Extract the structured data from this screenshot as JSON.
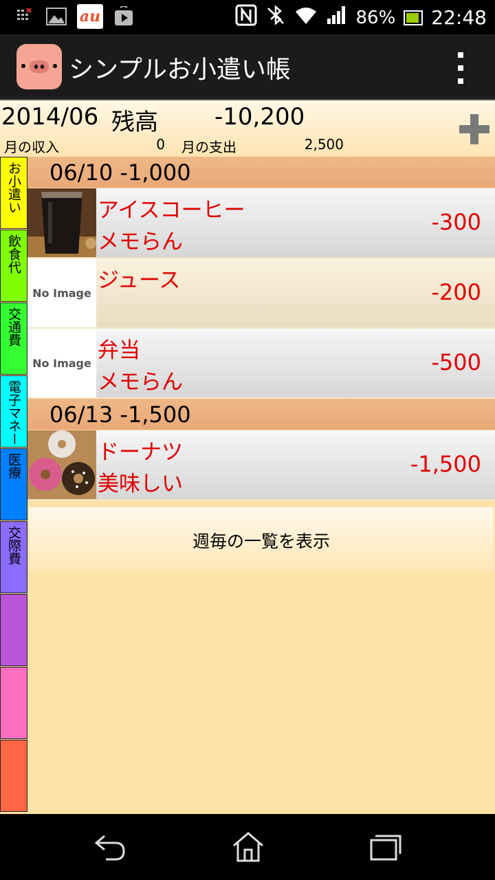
{
  "status_bar": {
    "battery": "86%",
    "time": "22:48",
    "carrier_logo": "au"
  },
  "app": {
    "title": "シンプルお小遣い帳"
  },
  "summary": {
    "month": "2014/06",
    "balance_label": "残高",
    "balance": "-10,200",
    "income_label": "月の収入",
    "income": "0",
    "expense_label": "月の支出",
    "expense": "2,500"
  },
  "categories": [
    {
      "label": "お小遣い",
      "color": "#ffff00"
    },
    {
      "label": "飲食代",
      "color": "#80ff00"
    },
    {
      "label": "交通費",
      "color": "#33ff33"
    },
    {
      "label": "電子マネー",
      "color": "#00ffff"
    },
    {
      "label": "医療",
      "color": "#0080ff"
    },
    {
      "label": "交際費",
      "color": "#8a6dff"
    },
    {
      "label": "",
      "color": "#b855d8"
    },
    {
      "label": "",
      "color": "#ff6fbf"
    },
    {
      "label": "",
      "color": "#ff6644"
    }
  ],
  "groups": [
    {
      "header": "06/10  -1,000",
      "items": [
        {
          "name": "アイスコーヒー",
          "memo": "メモらん",
          "amount": "-300",
          "image": "iced-coffee-photo"
        },
        {
          "name": "ジュース",
          "memo": "",
          "amount": "-200",
          "image_text": "No Image"
        },
        {
          "name": "弁当",
          "memo": "メモらん",
          "amount": "-500",
          "image_text": "No Image"
        }
      ]
    },
    {
      "header": "06/13  -1,500",
      "items": [
        {
          "name": "ドーナツ",
          "memo": "美味しい",
          "amount": "-1,500",
          "image": "donuts-photo"
        }
      ]
    }
  ],
  "weekly_button": "週毎の一覧を表示"
}
